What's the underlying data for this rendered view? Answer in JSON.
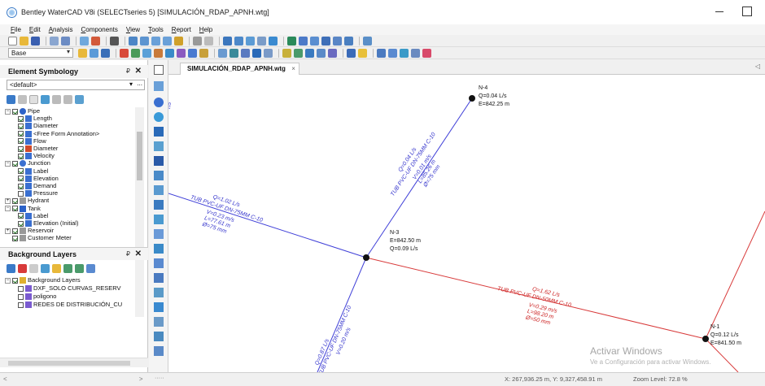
{
  "window": {
    "title": "Bentley WaterCAD V8i (SELECTseries 5) [SIMULACIÓN_RDAP_APNH.wtg]",
    "minimize_icon": "minimize-icon",
    "maximize_icon": "maximize-icon"
  },
  "menu": [
    "File",
    "Edit",
    "Analysis",
    "Components",
    "View",
    "Tools",
    "Report",
    "Help"
  ],
  "toolbar": {
    "scenario": "Base"
  },
  "element_symbology": {
    "title": "Element Symbology",
    "pin": "₽",
    "close": "✕",
    "dropdown_value": "<default>",
    "dropdown_more": "...",
    "tree": [
      {
        "label": "Pipe",
        "level": 0,
        "expander": "−",
        "checked": true,
        "icon": "pipe-icon",
        "color": "#2c62c8"
      },
      {
        "label": "Length",
        "level": 2,
        "checked": true,
        "icon": "annotation-icon",
        "color": "#3a6fd0"
      },
      {
        "label": "Diameter",
        "level": 2,
        "checked": true,
        "icon": "annotation-icon",
        "color": "#3a6fd0"
      },
      {
        "label": "<Free Form Annotation>",
        "level": 2,
        "checked": true,
        "icon": "annotation-icon",
        "color": "#3a6fd0"
      },
      {
        "label": "Flow",
        "level": 2,
        "checked": true,
        "icon": "annotation-icon",
        "color": "#3a6fd0"
      },
      {
        "label": "Diameter",
        "level": 2,
        "checked": true,
        "icon": "color-coding-icon",
        "color": "#d04a2a"
      },
      {
        "label": "Velocity",
        "level": 2,
        "checked": true,
        "icon": "annotation-icon",
        "color": "#3a6fd0"
      },
      {
        "label": "Junction",
        "level": 0,
        "expander": "−",
        "checked": true,
        "icon": "junction-icon",
        "color": "#3a6fd0"
      },
      {
        "label": "Label",
        "level": 2,
        "checked": true,
        "icon": "annotation-icon",
        "color": "#3a6fd0"
      },
      {
        "label": "Elevation",
        "level": 2,
        "checked": true,
        "icon": "annotation-icon",
        "color": "#3a6fd0"
      },
      {
        "label": "Demand",
        "level": 2,
        "checked": true,
        "icon": "annotation-icon",
        "color": "#3a6fd0"
      },
      {
        "label": "Pressure",
        "level": 2,
        "checked": false,
        "icon": "annotation-icon",
        "color": "#3a6fd0"
      },
      {
        "label": "Hydrant",
        "level": 0,
        "expander": "+",
        "checked": true,
        "icon": "hydrant-icon",
        "color": "#999999"
      },
      {
        "label": "Tank",
        "level": 0,
        "expander": "−",
        "checked": true,
        "icon": "tank-icon",
        "color": "#2c62c8"
      },
      {
        "label": "Label",
        "level": 2,
        "checked": true,
        "icon": "annotation-icon",
        "color": "#3a6fd0"
      },
      {
        "label": "Elevation (Initial)",
        "level": 2,
        "checked": true,
        "icon": "annotation-icon",
        "color": "#3a6fd0"
      },
      {
        "label": "Reservoir",
        "level": 0,
        "expander": "+",
        "checked": true,
        "icon": "reservoir-icon",
        "color": "#999999"
      },
      {
        "label": "Customer Meter",
        "level": 0,
        "checked": true,
        "icon": "customer-meter-icon",
        "color": "#999999"
      }
    ]
  },
  "background_layers": {
    "title": "Background Layers",
    "pin": "₽",
    "close": "✕",
    "tree": [
      {
        "label": "Background Layers",
        "level": 0,
        "expander": "−",
        "checked": true,
        "icon": "folder-icon",
        "color": "#e0b030"
      },
      {
        "label": "DXF_SOLO CURVAS_RESERV",
        "level": 2,
        "checked": false,
        "icon": "layer-icon",
        "color": "#7a5ad0"
      },
      {
        "label": "poligono",
        "level": 2,
        "checked": false,
        "icon": "layer-icon",
        "color": "#7a5ad0"
      },
      {
        "label": "REDES DE DISTRIBUCIÓN_CU",
        "level": 2,
        "checked": false,
        "icon": "layer-icon",
        "color": "#7a5ad0"
      }
    ]
  },
  "drawing": {
    "tab_label": "SIMULACIÓN_RDAP_APNH.wtg",
    "tab_close": "×",
    "tab_arrow": "◁",
    "edge_mark": "n5",
    "nodes": [
      {
        "id": "N-4",
        "lines": [
          "N-4",
          "Q=0.04 L/s",
          "E=842.25 m"
        ]
      },
      {
        "id": "N-3",
        "lines": [
          "N-3",
          "E=842.50 m",
          "Q=0.09 L/s"
        ]
      },
      {
        "id": "N-1",
        "lines": [
          "N-1",
          "Q=0.12 L/s",
          "E=841.50 m"
        ]
      }
    ],
    "pipes": [
      {
        "id": "left",
        "color": "#4040d8",
        "lines": [
          "Q=1.02 L/s",
          "TUB PVC-UF DN-75MM C-10",
          "V=0.23 m/s",
          "L=77.61 m",
          "Ø=75 mm"
        ]
      },
      {
        "id": "upper",
        "color": "#4040d8",
        "lines": [
          "Q=0.04 L/s",
          "TUB PVC-UF DN-75MM C-10",
          "V=0.01 m/s",
          "L=85.26 m",
          "Ø=75 mm"
        ]
      },
      {
        "id": "right",
        "color": "#d83a3a",
        "lines": [
          "Q=1.62 L/s",
          "TUB PVC-UF DN-50MM C-10",
          "V=0.29 m/s",
          "L=98.20 m",
          "Ø=50 mm"
        ]
      },
      {
        "id": "lower",
        "color": "#4040d8",
        "lines": [
          "Q=0.87 L/s",
          "TUB PVC-UF DN-75MM C-10",
          "V=0.20 m/s"
        ]
      }
    ]
  },
  "watermark": {
    "line1": "Activar Windows",
    "line2": "Ve a Configuración para activar Windows."
  },
  "status": {
    "coordinates": "X: 267,936.25 m, Y: 9,327,458.91 m",
    "zoom": "Zoom Level: 72.8 %",
    "left_arrows": "<",
    "left_arrows_right": ">",
    "vt_bottom": "·····"
  },
  "colors": {
    "pipe_blue": "#4040d8",
    "pipe_red": "#d83a3a",
    "accent": "#2c62c8"
  }
}
